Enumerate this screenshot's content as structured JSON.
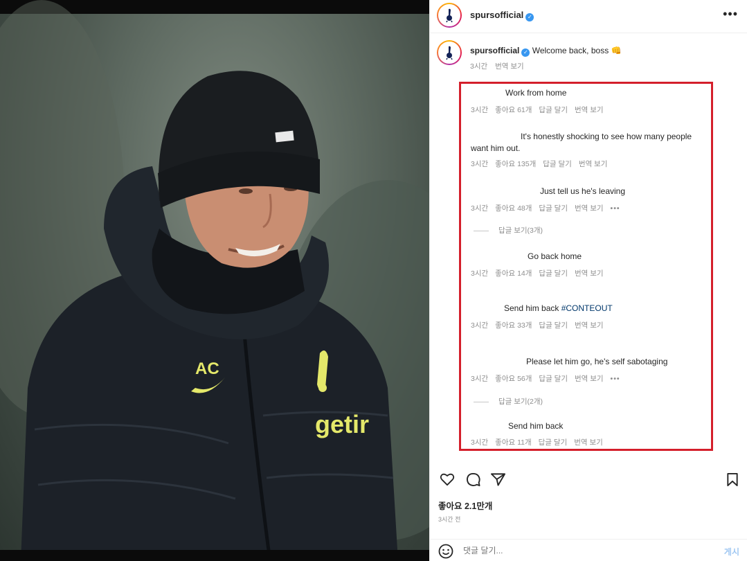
{
  "header": {
    "username": "spursofficial",
    "more_icon": "more-horizontal-icon"
  },
  "caption": {
    "username": "spursofficial",
    "text": "Welcome back, boss 👊",
    "time": "3시간",
    "translate": "번역 보기"
  },
  "comments": [
    {
      "text": "Work from home",
      "time": "3시간",
      "likes": "좋아요 61개",
      "reply": "답글 달기",
      "translate": "번역 보기"
    },
    {
      "text": "It's honestly shocking to see how many people want him out.",
      "time": "3시간",
      "likes": "좋아요 135개",
      "reply": "답글 달기",
      "translate": "번역 보기"
    },
    {
      "text": "Just tell us he's leaving",
      "time": "3시간",
      "likes": "좋아요 48개",
      "reply": "답글 달기",
      "translate": "번역 보기",
      "more": "•••",
      "view_replies": "답글 보기(3개)"
    },
    {
      "text": "Go back home",
      "time": "3시간",
      "likes": "좋아요 14개",
      "reply": "답글 달기",
      "translate": "번역 보기"
    },
    {
      "text_prefix": "Send him back ",
      "hashtag": "#CONTEOUT",
      "time": "3시간",
      "likes": "좋아요 33개",
      "reply": "답글 달기",
      "translate": "번역 보기"
    },
    {
      "text": "Please let him go, he's self sabotaging",
      "time": "3시간",
      "likes": "좋아요 56개",
      "reply": "답글 달기",
      "translate": "번역 보기",
      "more": "•••",
      "view_replies": "답글 보기(2개)"
    },
    {
      "text": "Send him back",
      "time": "3시간",
      "likes": "좋아요 11개",
      "reply": "답글 달기",
      "translate": "번역 보기"
    }
  ],
  "post": {
    "likes": "좋아요 2.1만개",
    "time_ago": "3시간 전",
    "comment_placeholder": "댓글 달기...",
    "post_button": "게시"
  },
  "photo": {
    "jacket_initials": "AC",
    "sponsor": "getir"
  },
  "colors": {
    "highlight_border": "#d41f2b",
    "verified": "#3897f0",
    "hashtag": "#00376b",
    "kit_yellow": "#e4e86a"
  }
}
